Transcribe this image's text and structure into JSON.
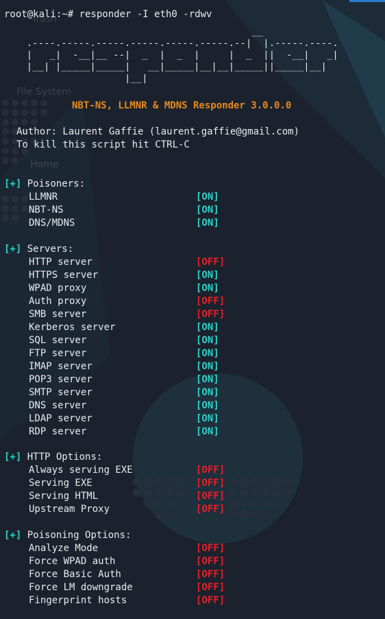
{
  "command_prompt": "root@kali:~# responder -I eth0 -rdwv",
  "ascii_logo": [
    "                                         __",
    "  .----.-----.-----.-----.-----.-----.--|  |.-----.----.",
    "  |   _|  -__|__ --|  _  |  _  |     |  _  ||  -__|   _|",
    "  |__| |_____|_____|   __|_____|__|__|_____||_____|__|",
    "                   |__|"
  ],
  "banner": "NBT-NS, LLMNR & MDNS Responder 3.0.0.0",
  "author_line": "Author: Laurent Gaffie (laurent.gaffie@gmail.com)",
  "kill_line": "To kill this script hit CTRL-C",
  "desktop_icons": {
    "trash": "Trash",
    "filesystem": "File System",
    "home": "Home"
  },
  "sections": [
    {
      "tag": "[+]",
      "title": "Poisoners:",
      "items": [
        {
          "label": "LLMNR",
          "state": "[ON]",
          "on": true
        },
        {
          "label": "NBT-NS",
          "state": "[ON]",
          "on": true
        },
        {
          "label": "DNS/MDNS",
          "state": "[ON]",
          "on": true
        }
      ]
    },
    {
      "tag": "[+]",
      "title": "Servers:",
      "items": [
        {
          "label": "HTTP server",
          "state": "[OFF]",
          "on": false
        },
        {
          "label": "HTTPS server",
          "state": "[ON]",
          "on": true
        },
        {
          "label": "WPAD proxy",
          "state": "[ON]",
          "on": true
        },
        {
          "label": "Auth proxy",
          "state": "[OFF]",
          "on": false
        },
        {
          "label": "SMB server",
          "state": "[OFF]",
          "on": false
        },
        {
          "label": "Kerberos server",
          "state": "[ON]",
          "on": true
        },
        {
          "label": "SQL server",
          "state": "[ON]",
          "on": true
        },
        {
          "label": "FTP server",
          "state": "[ON]",
          "on": true
        },
        {
          "label": "IMAP server",
          "state": "[ON]",
          "on": true
        },
        {
          "label": "POP3 server",
          "state": "[ON]",
          "on": true
        },
        {
          "label": "SMTP server",
          "state": "[ON]",
          "on": true
        },
        {
          "label": "DNS server",
          "state": "[ON]",
          "on": true
        },
        {
          "label": "LDAP server",
          "state": "[ON]",
          "on": true
        },
        {
          "label": "RDP server",
          "state": "[ON]",
          "on": true
        }
      ]
    },
    {
      "tag": "[+]",
      "title": "HTTP Options:",
      "items": [
        {
          "label": "Always serving EXE",
          "state": "[OFF]",
          "on": false
        },
        {
          "label": "Serving EXE",
          "state": "[OFF]",
          "on": false
        },
        {
          "label": "Serving HTML",
          "state": "[OFF]",
          "on": false
        },
        {
          "label": "Upstream Proxy",
          "state": "[OFF]",
          "on": false
        }
      ]
    },
    {
      "tag": "[+]",
      "title": "Poisoning Options:",
      "items": [
        {
          "label": "Analyze Mode",
          "state": "[OFF]",
          "on": false
        },
        {
          "label": "Force WPAD auth",
          "state": "[OFF]",
          "on": false
        },
        {
          "label": "Force Basic Auth",
          "state": "[OFF]",
          "on": false
        },
        {
          "label": "Force LM downgrade",
          "state": "[OFF]",
          "on": false
        },
        {
          "label": "Fingerprint hosts",
          "state": "[OFF]",
          "on": false
        }
      ]
    }
  ],
  "colors": {
    "on": "#2fd1c9",
    "off": "#e8202a",
    "banner": "#e58a1f",
    "text": "#e8ecef",
    "background": "#1e2632"
  }
}
